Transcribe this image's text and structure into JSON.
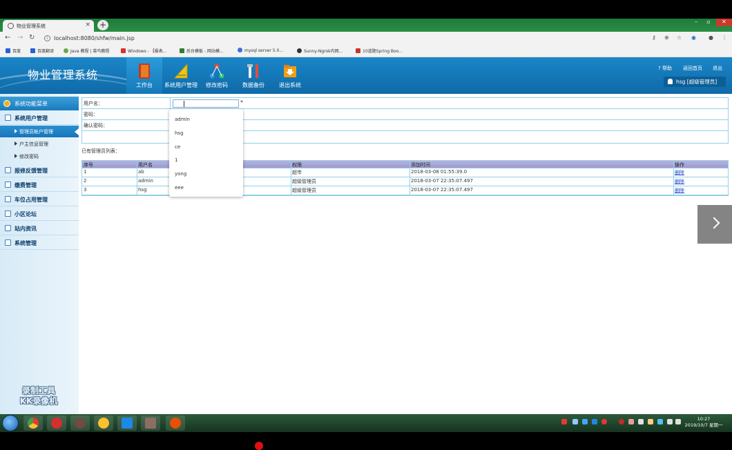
{
  "browser": {
    "tab_title": "物业管理系统",
    "tab_close": "×",
    "new_tab": "+",
    "url": "localhost:8080/shfw/main.jsp",
    "bookmarks": [
      "百度",
      "百度翻译",
      "Java 教程 | 菜鸟教程",
      "Windows - 【报表...",
      "后台模板 - 网站模...",
      "mysql server 5.0...",
      "Sunny-Ngrok内网...",
      "10道题Spring Boo..."
    ]
  },
  "header": {
    "system_name": "物业管理系统",
    "nav": [
      {
        "label": "工作台"
      },
      {
        "label": "系统用户管理"
      },
      {
        "label": "修改密码"
      },
      {
        "label": "数据备份"
      },
      {
        "label": "退出系统"
      }
    ],
    "help": "帮助",
    "home": "返回首页",
    "logout": "退出",
    "user": "hsg [超级管理员]"
  },
  "sidebar": {
    "title": "系统功能菜单",
    "group1": "系统用户管理",
    "sub": [
      "管理员帐户管理",
      "户主信息管理",
      "修改密码"
    ],
    "items": [
      "报修反馈管理",
      "缴费管理",
      "车位占用管理",
      "小区论坛",
      "站内资讯",
      "系统管理"
    ],
    "watermark_line1": "录制工具",
    "watermark_line2": "KK录像机"
  },
  "form": {
    "username_label": "用户名：",
    "password_label": "密码：",
    "confirm_label": "确认密码：",
    "required_mark": "*"
  },
  "autocomplete": [
    "admin",
    "hsg",
    "ce",
    "1",
    "yong",
    "eee"
  ],
  "list": {
    "title": "已有管理员列表：",
    "columns": [
      "序号",
      "用户名",
      "权限",
      "添加时间",
      "操作"
    ],
    "rows": [
      {
        "no": "1",
        "user": "ab",
        "role": "超市",
        "time": "2018-03-08 01:55:39.0",
        "op": "删除"
      },
      {
        "no": "2",
        "user": "admin",
        "role": "超级管理员",
        "time": "2018-03-07 22:35:07.497",
        "op": "删除"
      },
      {
        "no": "3",
        "user": "hsg",
        "role": "超级管理员",
        "time": "2018-03-07 22:35:07.497",
        "op": "删除"
      }
    ]
  },
  "taskbar": {
    "time": "10:27",
    "date": "2019/10/7 星期一"
  },
  "colors": {
    "header_blue": "#1a86c8",
    "table_border": "#8fd0e8",
    "table_header": "#b6b2dd",
    "link_blue": "#2244cc"
  }
}
